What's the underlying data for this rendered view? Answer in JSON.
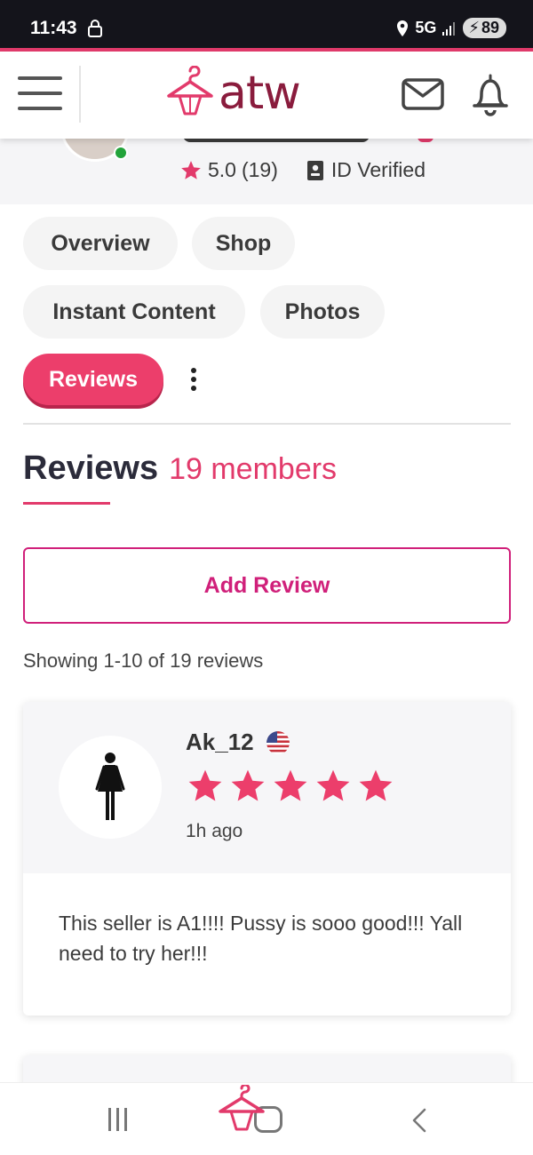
{
  "status_bar": {
    "time": "11:43",
    "network": "5G",
    "battery": "89"
  },
  "header": {
    "logo_text": "atw",
    "brand_color": "#8a1c3d",
    "icons": [
      "menu-icon",
      "hanger-logo-icon",
      "mail-icon",
      "bell-icon"
    ]
  },
  "profile": {
    "rating": "5.0",
    "rating_count": "(19)",
    "verification": "ID Verified"
  },
  "tabs": [
    {
      "label": "Overview",
      "active": false
    },
    {
      "label": "Shop",
      "active": false
    },
    {
      "label": "Instant Content",
      "active": false
    },
    {
      "label": "Photos",
      "active": false
    },
    {
      "label": "Reviews",
      "active": true
    }
  ],
  "reviews": {
    "title": "Reviews",
    "members": "19 members",
    "add_button": "Add Review",
    "showing": "Showing 1-10 of 19 reviews",
    "items": [
      {
        "name": "Ak_12",
        "country_flag": "us-flag-icon",
        "stars": 5,
        "time": "1h ago",
        "text": "This seller is A1!!!! Pussy is sooo good!!! Yall need to try her!!!"
      }
    ]
  },
  "colors": {
    "accent": "#e23a6b",
    "button_outline": "#d0207a",
    "online": "#22a33a"
  }
}
